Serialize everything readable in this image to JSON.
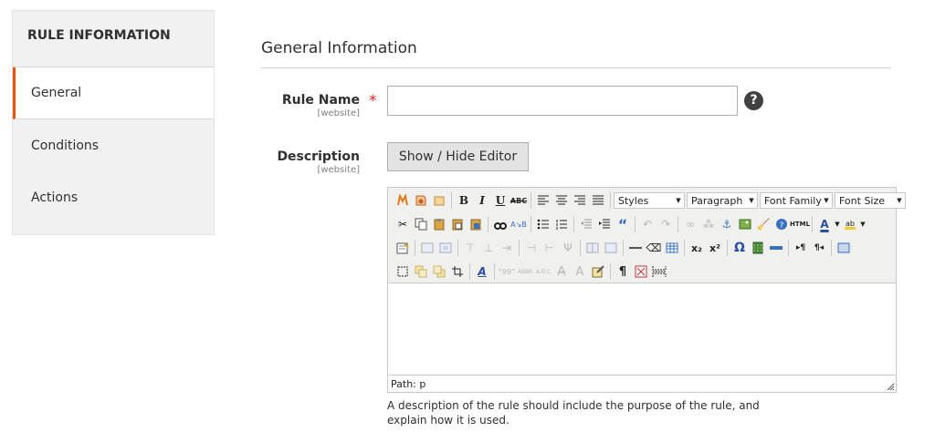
{
  "sidebar": {
    "title": "RULE INFORMATION",
    "items": [
      {
        "label": "General",
        "active": true
      },
      {
        "label": "Conditions",
        "active": false
      },
      {
        "label": "Actions",
        "active": false
      }
    ]
  },
  "section": {
    "title": "General Information"
  },
  "fields": {
    "rule_name": {
      "label": "Rule Name",
      "scope": "[website]",
      "required_mark": "*",
      "value": "",
      "help": "?"
    },
    "description": {
      "label": "Description",
      "scope": "[website]",
      "toggle_button": "Show / Hide Editor"
    }
  },
  "editor": {
    "dropdowns": {
      "styles": "Styles",
      "format": "Paragraph",
      "font_family": "Font Family",
      "font_size": "Font Size"
    },
    "path_label": "Path: p",
    "html_button": "HTML"
  },
  "note": "A description of the rule should include the purpose of the rule, and explain how it is used.",
  "colors": {
    "accent": "#eb5202",
    "required": "#e22626"
  }
}
